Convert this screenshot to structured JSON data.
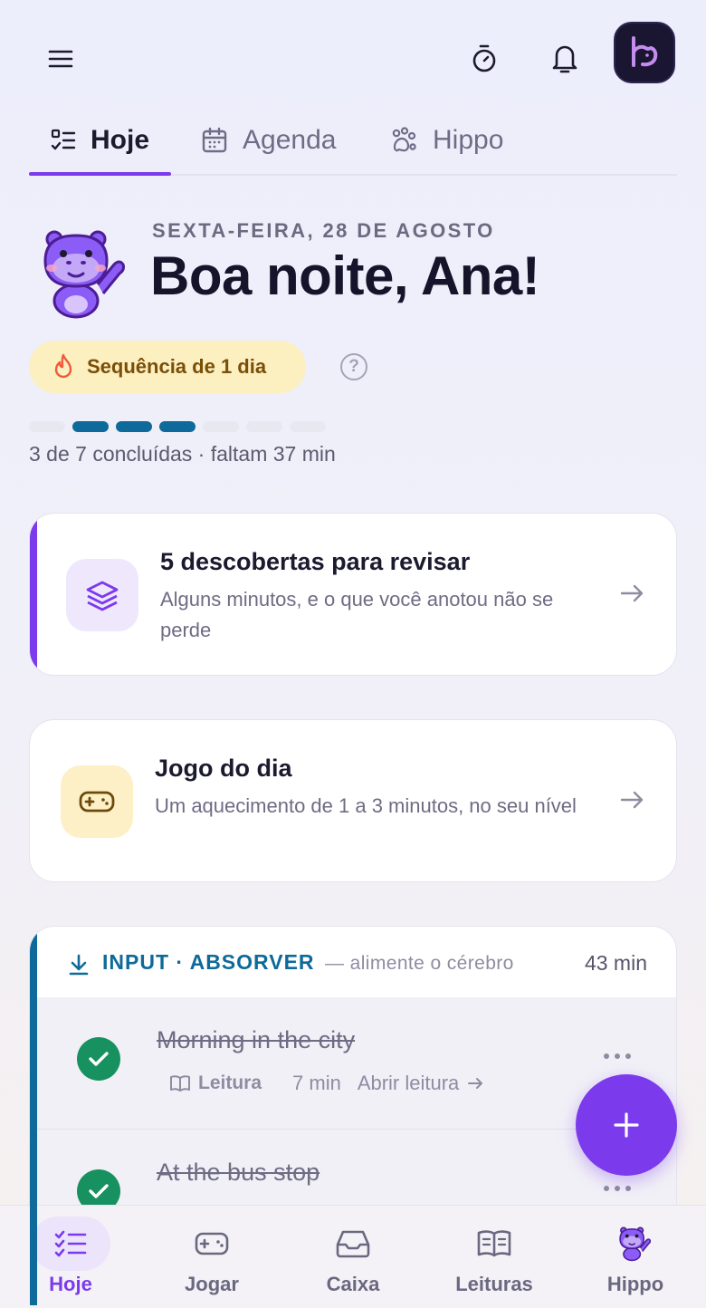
{
  "header": {
    "menu_icon": "hamburger-menu-icon",
    "timer_icon": "stopwatch-icon",
    "bell_icon": "bell-icon",
    "avatar_icon": "brand-logo-icon"
  },
  "tabs": [
    {
      "label": "Hoje",
      "icon": "checklist-icon",
      "active": true
    },
    {
      "label": "Agenda",
      "icon": "calendar-icon",
      "active": false
    },
    {
      "label": "Hippo",
      "icon": "paw-icon",
      "active": false
    }
  ],
  "hero": {
    "date": "SEXTA-FEIRA, 28 DE AGOSTO",
    "greeting": "Boa noite, Ana!"
  },
  "streak": {
    "label": "Sequência de 1 dia",
    "icon": "flame-icon",
    "help_icon": "question-circle-icon"
  },
  "progress": {
    "completed": 3,
    "total": 7,
    "text": "3 de 7 concluídas · faltam 37 min"
  },
  "cards": {
    "review": {
      "title": "5 descobertas para revisar",
      "subtitle": "Alguns minutos, e o que você anotou não se perde",
      "icon": "layers-icon"
    },
    "game": {
      "title": "Jogo do dia",
      "subtitle": "Um aquecimento de 1 a 3 minutos, no seu nível",
      "icon": "gamepad-icon"
    }
  },
  "input_section": {
    "label": "INPUT · ABSORVER",
    "hint": "— alimente o cérebro",
    "time": "43 min",
    "tasks": [
      {
        "title": "Morning in the city",
        "type": "Leitura",
        "duration": "7 min",
        "action": "Abrir leitura",
        "done": true
      },
      {
        "title": "At the bus stop",
        "done": true
      }
    ]
  },
  "fab": {
    "icon": "plus-icon"
  },
  "bottom_nav": [
    {
      "label": "Hoje",
      "icon": "checklist-icon",
      "active": true
    },
    {
      "label": "Jogar",
      "icon": "gamepad-icon",
      "active": false
    },
    {
      "label": "Caixa",
      "icon": "inbox-icon",
      "active": false
    },
    {
      "label": "Leituras",
      "icon": "book-open-icon",
      "active": false
    },
    {
      "label": "Hippo",
      "icon": "hippo-mascot-icon",
      "active": false
    }
  ],
  "colors": {
    "accent": "#7c3aed",
    "input_blue": "#0e6a9a",
    "success": "#17915f",
    "streak_bg": "#fcefc0"
  }
}
